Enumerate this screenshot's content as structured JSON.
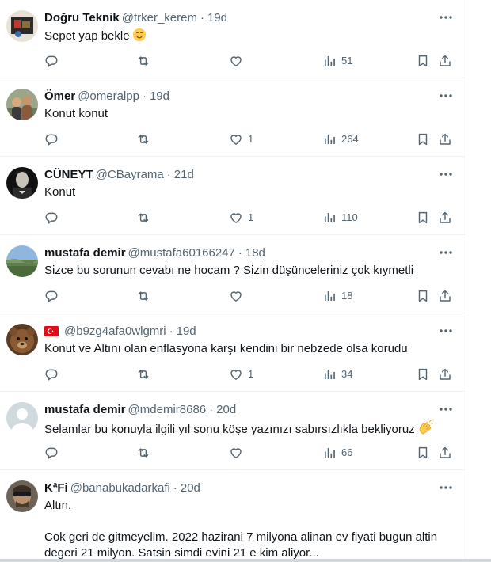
{
  "replies": [
    {
      "name": "Doğru Teknik",
      "handle": "@trker_kerem",
      "time": "19d",
      "text": [
        "Sepet yap bekle"
      ],
      "emoji": "smiling-face-icon",
      "likes": "",
      "views": "51"
    },
    {
      "name": "Ömer",
      "handle": "@omeralpp",
      "time": "19d",
      "text": [
        "Konut konut"
      ],
      "likes": "1",
      "views": "264"
    },
    {
      "name": "CÜNEYT",
      "handle": "@CBayrama",
      "time": "21d",
      "text": [
        "Konut"
      ],
      "likes": "1",
      "views": "110"
    },
    {
      "name": "mustafa demir",
      "handle": "@mustafa60166247",
      "time": "18d",
      "text": [
        "Sizce bu sorunun cevabı ne hocam ? Sizin düşünceleriniz çok kıymetli"
      ],
      "likes": "",
      "views": "18"
    },
    {
      "name": "",
      "flag": "turkey-flag-icon",
      "handle": "@b9zg4afa0wlgmri",
      "time": "19d",
      "text": [
        "Konut ve Altını olan enflasyona karşı kendini bir nebzede olsa korudu"
      ],
      "likes": "1",
      "views": "34"
    },
    {
      "name": "mustafa demir",
      "handle": "@mdemir8686",
      "time": "20d",
      "text": [
        "Selamlar bu konuyla ilgili yıl sonu köşe yazınızı sabırsızlıkla bekliyoruz"
      ],
      "emoji": "clapping-hands-icon",
      "likes": "",
      "views": "66"
    },
    {
      "name": "KªFi",
      "handle": "@banabukadarkafi",
      "time": "20d",
      "text": [
        "Altın.",
        "Cok geri de gitmeyelim. 2022 hazirani 7 milyona alinan ev fiyati bugun altin degeri 21 milyon. Satsin simdi evini 21 e kim aliyor..."
      ],
      "likes": "",
      "views": ""
    }
  ],
  "separator": "·",
  "colors": {
    "text": "#0f1419",
    "muted": "#536471",
    "border": "#eff3f4"
  }
}
